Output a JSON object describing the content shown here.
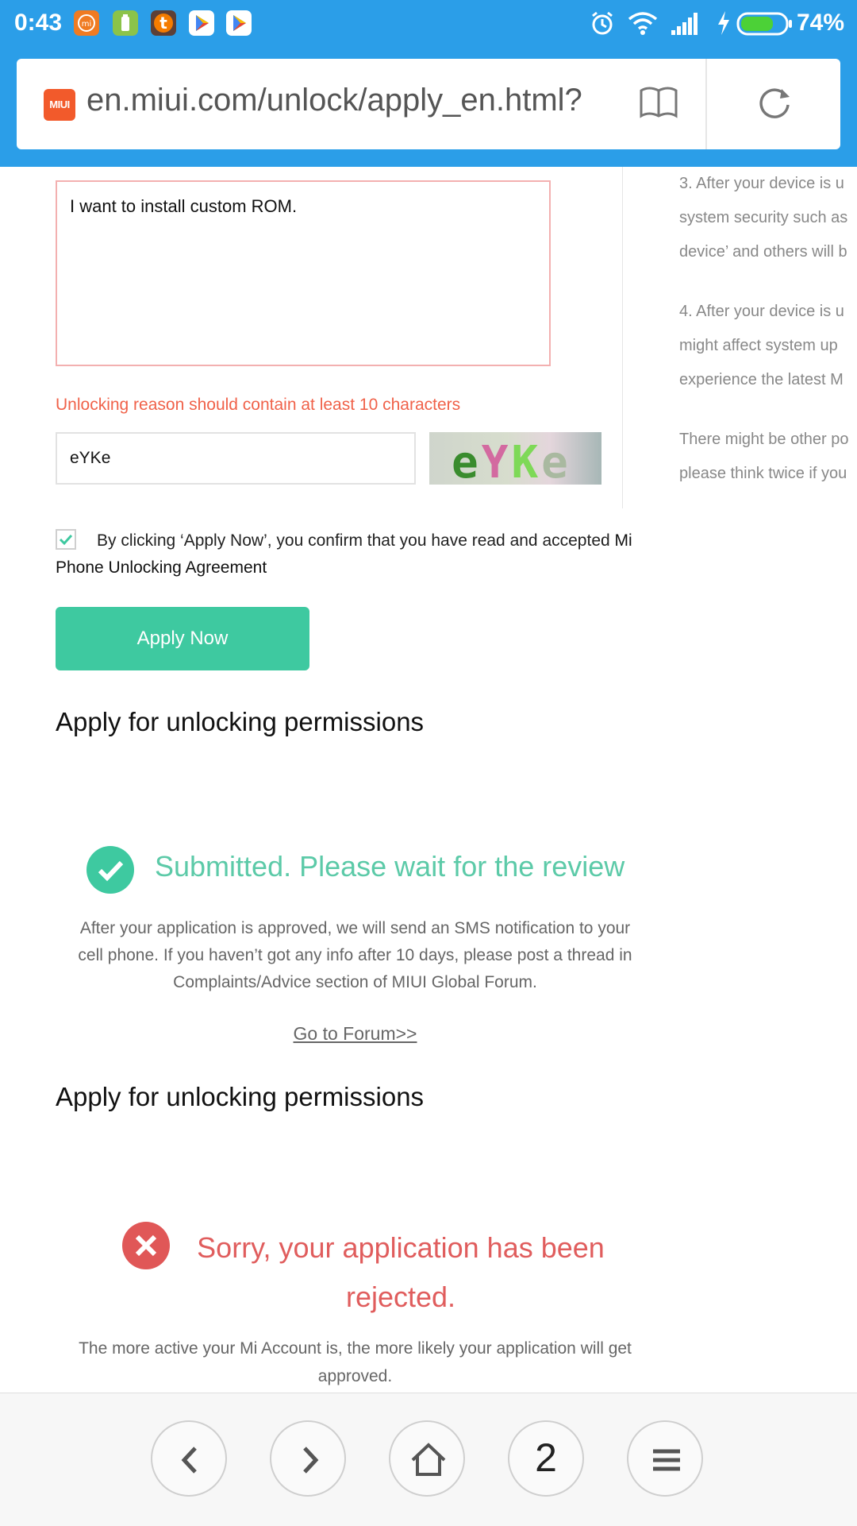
{
  "status_bar": {
    "time": "0:43",
    "battery_percent": "74%",
    "battery_level": 0.74,
    "notification_icons": [
      "mi-icon",
      "battery-app-icon",
      "t-app-icon",
      "play-store-icon",
      "play-store-icon"
    ],
    "status_icons": [
      "alarm-icon",
      "wifi-icon",
      "signal-icon",
      "charging-icon",
      "battery-icon"
    ]
  },
  "browser": {
    "site_logo_text": "MIUI",
    "url": "en.miui.com/unlock/apply_en.html?",
    "tabs_count": "2"
  },
  "side_notes": {
    "p3": [
      "3. After your device is u",
      "system security such as",
      "device’ and others will b"
    ],
    "p4": [
      "4. After your device is u",
      "might affect system up",
      "experience the latest M"
    ],
    "p5": [
      "There might be other po",
      "please think twice if you"
    ]
  },
  "form": {
    "reason_value": "I want to install custom ROM.",
    "reason_error": "Unlocking reason should contain at least 10 characters",
    "captcha_value": "eYKe",
    "captcha_image_text": "eYKe",
    "agreement_text": "By clicking ‘Apply Now’, you confirm that you have read and accepted",
    "agreement_link": "Mi Phone Unlocking Agreement",
    "agreement_checked": true,
    "apply_button": "Apply Now"
  },
  "submitted_section": {
    "heading": "Apply for unlocking permissions",
    "title": "Submitted. Please wait for the review",
    "description": "After your application is approved, we will send an SMS notification to your cell phone. If you haven’t got any info after 10 days, please post a thread in Complaints/Advice section of MIUI Global Forum.",
    "forum_link": "Go to Forum>>"
  },
  "rejected_section": {
    "heading": "Apply for unlocking permissions",
    "title": "Sorry, your application has been rejected.",
    "description": "The more active your Mi Account is, the more likely your application will get approved."
  },
  "colors": {
    "status_bar_bg": "#2b9ee8",
    "accent_green": "#3ec9a0",
    "error_red": "#f0624a",
    "rejected_red": "#e05757"
  }
}
